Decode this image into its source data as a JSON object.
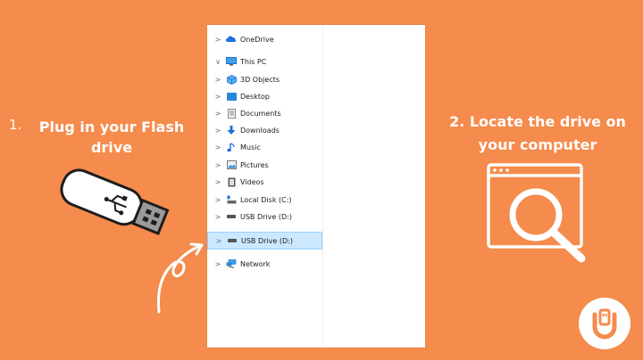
{
  "step1": {
    "number": "1.",
    "line1": "Plug in your Flash",
    "line2": "drive"
  },
  "step2": {
    "line1": "2. Locate the drive on",
    "line2": "your computer"
  },
  "explorer": {
    "items": [
      {
        "label": "OneDrive",
        "icon": "cloud-icon",
        "expanded": false
      },
      {
        "label": "This PC",
        "icon": "computer-icon",
        "expanded": true
      },
      {
        "label": "3D Objects",
        "icon": "cube-icon"
      },
      {
        "label": "Desktop",
        "icon": "desktop-icon"
      },
      {
        "label": "Documents",
        "icon": "document-icon"
      },
      {
        "label": "Downloads",
        "icon": "download-icon"
      },
      {
        "label": "Music",
        "icon": "music-icon"
      },
      {
        "label": "Pictures",
        "icon": "picture-icon"
      },
      {
        "label": "Videos",
        "icon": "video-icon"
      },
      {
        "label": "Local Disk (C:)",
        "icon": "disk-icon"
      },
      {
        "label": "USB Drive (D:)",
        "icon": "usb-drive-icon"
      },
      {
        "label": "USB Drive (D:)",
        "icon": "usb-drive-icon",
        "selected": true
      },
      {
        "label": "Network",
        "icon": "network-icon"
      }
    ]
  },
  "colors": {
    "background": "#F58B4C",
    "selection": "#CCE8FF",
    "white": "#FFFFFF"
  }
}
